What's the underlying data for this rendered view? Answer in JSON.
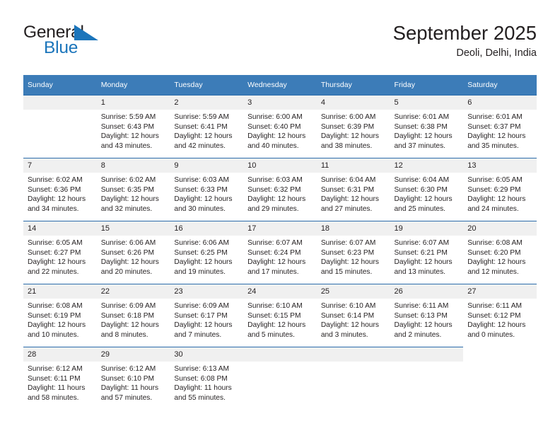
{
  "brand": {
    "name_part1": "General",
    "name_part2": "Blue",
    "mark": "triangle-mark"
  },
  "header": {
    "title": "September 2025",
    "subtitle": "Deoli, Delhi, India"
  },
  "colors": {
    "header_blue": "#3c7cb8",
    "row_rule_blue": "#2b6cab",
    "daynum_background": "#f0f0f0",
    "brand_blue": "#1b75bb",
    "text": "#231f20"
  },
  "weekdays": [
    "Sunday",
    "Monday",
    "Tuesday",
    "Wednesday",
    "Thursday",
    "Friday",
    "Saturday"
  ],
  "weeks": [
    [
      {
        "day": "",
        "state": "empty-lead",
        "sunrise": "",
        "sunset": "",
        "daylight1": "",
        "daylight2": ""
      },
      {
        "day": "1",
        "state": "filled",
        "sunrise": "Sunrise: 5:59 AM",
        "sunset": "Sunset: 6:43 PM",
        "daylight1": "Daylight: 12 hours",
        "daylight2": "and 43 minutes."
      },
      {
        "day": "2",
        "state": "filled",
        "sunrise": "Sunrise: 5:59 AM",
        "sunset": "Sunset: 6:41 PM",
        "daylight1": "Daylight: 12 hours",
        "daylight2": "and 42 minutes."
      },
      {
        "day": "3",
        "state": "filled",
        "sunrise": "Sunrise: 6:00 AM",
        "sunset": "Sunset: 6:40 PM",
        "daylight1": "Daylight: 12 hours",
        "daylight2": "and 40 minutes."
      },
      {
        "day": "4",
        "state": "filled",
        "sunrise": "Sunrise: 6:00 AM",
        "sunset": "Sunset: 6:39 PM",
        "daylight1": "Daylight: 12 hours",
        "daylight2": "and 38 minutes."
      },
      {
        "day": "5",
        "state": "filled",
        "sunrise": "Sunrise: 6:01 AM",
        "sunset": "Sunset: 6:38 PM",
        "daylight1": "Daylight: 12 hours",
        "daylight2": "and 37 minutes."
      },
      {
        "day": "6",
        "state": "filled",
        "sunrise": "Sunrise: 6:01 AM",
        "sunset": "Sunset: 6:37 PM",
        "daylight1": "Daylight: 12 hours",
        "daylight2": "and 35 minutes."
      }
    ],
    [
      {
        "day": "7",
        "state": "filled",
        "sunrise": "Sunrise: 6:02 AM",
        "sunset": "Sunset: 6:36 PM",
        "daylight1": "Daylight: 12 hours",
        "daylight2": "and 34 minutes."
      },
      {
        "day": "8",
        "state": "filled",
        "sunrise": "Sunrise: 6:02 AM",
        "sunset": "Sunset: 6:35 PM",
        "daylight1": "Daylight: 12 hours",
        "daylight2": "and 32 minutes."
      },
      {
        "day": "9",
        "state": "filled",
        "sunrise": "Sunrise: 6:03 AM",
        "sunset": "Sunset: 6:33 PM",
        "daylight1": "Daylight: 12 hours",
        "daylight2": "and 30 minutes."
      },
      {
        "day": "10",
        "state": "filled",
        "sunrise": "Sunrise: 6:03 AM",
        "sunset": "Sunset: 6:32 PM",
        "daylight1": "Daylight: 12 hours",
        "daylight2": "and 29 minutes."
      },
      {
        "day": "11",
        "state": "filled",
        "sunrise": "Sunrise: 6:04 AM",
        "sunset": "Sunset: 6:31 PM",
        "daylight1": "Daylight: 12 hours",
        "daylight2": "and 27 minutes."
      },
      {
        "day": "12",
        "state": "filled",
        "sunrise": "Sunrise: 6:04 AM",
        "sunset": "Sunset: 6:30 PM",
        "daylight1": "Daylight: 12 hours",
        "daylight2": "and 25 minutes."
      },
      {
        "day": "13",
        "state": "filled",
        "sunrise": "Sunrise: 6:05 AM",
        "sunset": "Sunset: 6:29 PM",
        "daylight1": "Daylight: 12 hours",
        "daylight2": "and 24 minutes."
      }
    ],
    [
      {
        "day": "14",
        "state": "filled",
        "sunrise": "Sunrise: 6:05 AM",
        "sunset": "Sunset: 6:27 PM",
        "daylight1": "Daylight: 12 hours",
        "daylight2": "and 22 minutes."
      },
      {
        "day": "15",
        "state": "filled",
        "sunrise": "Sunrise: 6:06 AM",
        "sunset": "Sunset: 6:26 PM",
        "daylight1": "Daylight: 12 hours",
        "daylight2": "and 20 minutes."
      },
      {
        "day": "16",
        "state": "filled",
        "sunrise": "Sunrise: 6:06 AM",
        "sunset": "Sunset: 6:25 PM",
        "daylight1": "Daylight: 12 hours",
        "daylight2": "and 19 minutes."
      },
      {
        "day": "17",
        "state": "filled",
        "sunrise": "Sunrise: 6:07 AM",
        "sunset": "Sunset: 6:24 PM",
        "daylight1": "Daylight: 12 hours",
        "daylight2": "and 17 minutes."
      },
      {
        "day": "18",
        "state": "filled",
        "sunrise": "Sunrise: 6:07 AM",
        "sunset": "Sunset: 6:23 PM",
        "daylight1": "Daylight: 12 hours",
        "daylight2": "and 15 minutes."
      },
      {
        "day": "19",
        "state": "filled",
        "sunrise": "Sunrise: 6:07 AM",
        "sunset": "Sunset: 6:21 PM",
        "daylight1": "Daylight: 12 hours",
        "daylight2": "and 13 minutes."
      },
      {
        "day": "20",
        "state": "filled",
        "sunrise": "Sunrise: 6:08 AM",
        "sunset": "Sunset: 6:20 PM",
        "daylight1": "Daylight: 12 hours",
        "daylight2": "and 12 minutes."
      }
    ],
    [
      {
        "day": "21",
        "state": "filled",
        "sunrise": "Sunrise: 6:08 AM",
        "sunset": "Sunset: 6:19 PM",
        "daylight1": "Daylight: 12 hours",
        "daylight2": "and 10 minutes."
      },
      {
        "day": "22",
        "state": "filled",
        "sunrise": "Sunrise: 6:09 AM",
        "sunset": "Sunset: 6:18 PM",
        "daylight1": "Daylight: 12 hours",
        "daylight2": "and 8 minutes."
      },
      {
        "day": "23",
        "state": "filled",
        "sunrise": "Sunrise: 6:09 AM",
        "sunset": "Sunset: 6:17 PM",
        "daylight1": "Daylight: 12 hours",
        "daylight2": "and 7 minutes."
      },
      {
        "day": "24",
        "state": "filled",
        "sunrise": "Sunrise: 6:10 AM",
        "sunset": "Sunset: 6:15 PM",
        "daylight1": "Daylight: 12 hours",
        "daylight2": "and 5 minutes."
      },
      {
        "day": "25",
        "state": "filled",
        "sunrise": "Sunrise: 6:10 AM",
        "sunset": "Sunset: 6:14 PM",
        "daylight1": "Daylight: 12 hours",
        "daylight2": "and 3 minutes."
      },
      {
        "day": "26",
        "state": "filled",
        "sunrise": "Sunrise: 6:11 AM",
        "sunset": "Sunset: 6:13 PM",
        "daylight1": "Daylight: 12 hours",
        "daylight2": "and 2 minutes."
      },
      {
        "day": "27",
        "state": "filled",
        "sunrise": "Sunrise: 6:11 AM",
        "sunset": "Sunset: 6:12 PM",
        "daylight1": "Daylight: 12 hours",
        "daylight2": "and 0 minutes."
      }
    ],
    [
      {
        "day": "28",
        "state": "filled",
        "sunrise": "Sunrise: 6:12 AM",
        "sunset": "Sunset: 6:11 PM",
        "daylight1": "Daylight: 11 hours",
        "daylight2": "and 58 minutes."
      },
      {
        "day": "29",
        "state": "filled",
        "sunrise": "Sunrise: 6:12 AM",
        "sunset": "Sunset: 6:10 PM",
        "daylight1": "Daylight: 11 hours",
        "daylight2": "and 57 minutes."
      },
      {
        "day": "30",
        "state": "filled",
        "sunrise": "Sunrise: 6:13 AM",
        "sunset": "Sunset: 6:08 PM",
        "daylight1": "Daylight: 11 hours",
        "daylight2": "and 55 minutes."
      },
      {
        "day": "",
        "state": "empty-lead",
        "sunrise": "",
        "sunset": "",
        "daylight1": "",
        "daylight2": ""
      },
      {
        "day": "",
        "state": "empty-lead",
        "sunrise": "",
        "sunset": "",
        "daylight1": "",
        "daylight2": ""
      },
      {
        "day": "",
        "state": "empty-lead",
        "sunrise": "",
        "sunset": "",
        "daylight1": "",
        "daylight2": ""
      },
      {
        "day": "",
        "state": "blank",
        "sunrise": "",
        "sunset": "",
        "daylight1": "",
        "daylight2": ""
      }
    ]
  ]
}
